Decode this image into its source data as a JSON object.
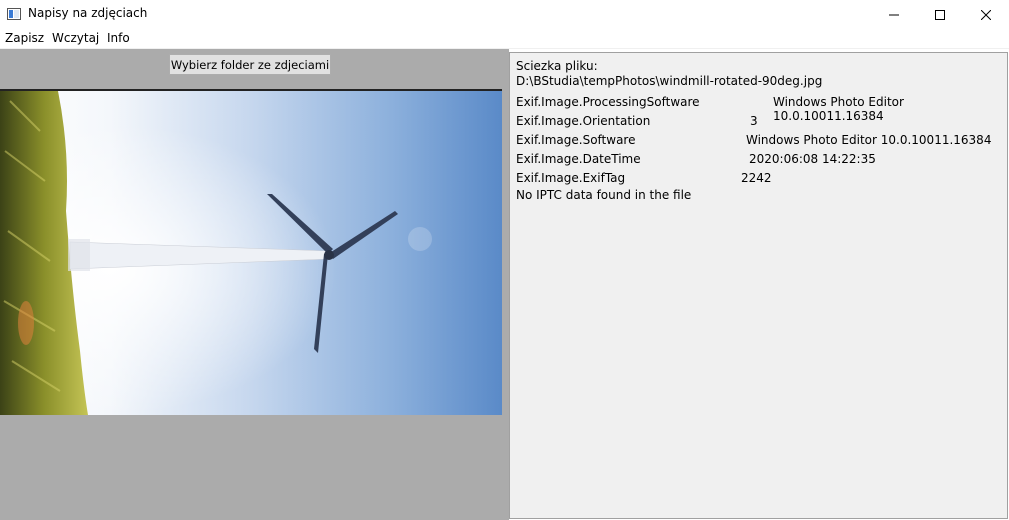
{
  "window": {
    "title": "Napisy na zdjęciach"
  },
  "menu": {
    "items": [
      "Zapisz",
      "Wczytaj",
      "Info"
    ]
  },
  "left_panel": {
    "choose_folder_label": "Wybierz folder ze zdjeciami",
    "photo_description_icon": "windmill-photo"
  },
  "right_panel": {
    "path_label": "Sciezka pliku:",
    "path_value": "D:\\BStudia\\tempPhotos\\windmill-rotated-90deg.jpg",
    "exif": [
      {
        "key": "Exif.Image.ProcessingSoftware",
        "value": "Windows Photo Editor 10.0.10011.16384"
      },
      {
        "key": "Exif.Image.Orientation",
        "value": "3"
      },
      {
        "key": "Exif.Image.Software",
        "value": "Windows Photo Editor 10.0.10011.16384"
      },
      {
        "key": "Exif.Image.DateTime",
        "value": "2020:06:08 14:22:35"
      },
      {
        "key": "Exif.Image.ExifTag",
        "value": "2242"
      }
    ],
    "iptc_message": "No IPTC data found in the file"
  },
  "colors": {
    "panel_gray": "#ababab",
    "info_background": "#f0f0f0",
    "sky_blue": "#5a8ac8"
  }
}
